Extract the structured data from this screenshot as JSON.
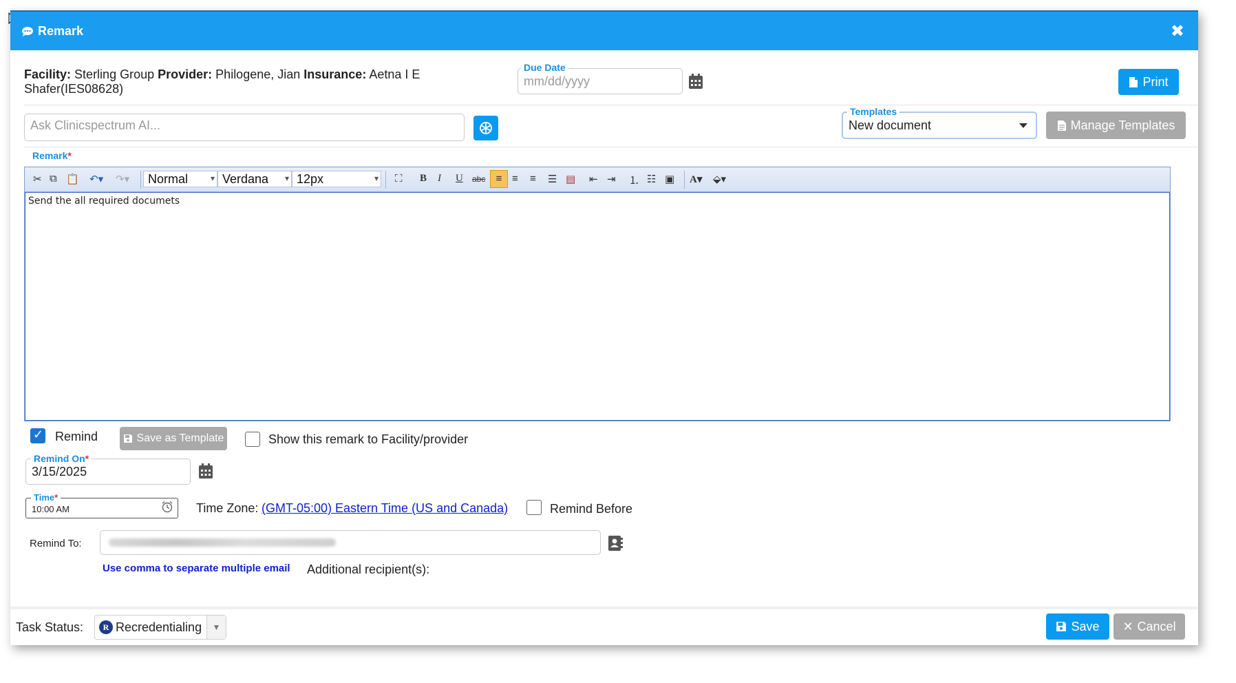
{
  "dialog": {
    "title": "Remark",
    "close_symbol": "✖"
  },
  "info": {
    "facility_label": "Facility:",
    "facility_value": "Sterling Group",
    "provider_label": "Provider:",
    "provider_value": "Philogene, Jian",
    "insurance_label": "Insurance:",
    "insurance_value": "Aetna I E Shafer(IES08628)"
  },
  "due_date": {
    "label": "Due Date",
    "placeholder": "mm/dd/yyyy"
  },
  "print_label": "Print",
  "ai": {
    "placeholder": "Ask Clinicspectrum AI..."
  },
  "templates": {
    "label": "Templates",
    "selected": "New document",
    "manage_label": "Manage Templates"
  },
  "remark": {
    "label": "Remark",
    "required_mark": "*",
    "body": "Send the all required documets"
  },
  "toolbar": {
    "format": "Normal",
    "font": "Verdana",
    "size": "12px",
    "bold": "B",
    "italic": "I",
    "underline": "U",
    "strike": "abc",
    "font_color": "A"
  },
  "options": {
    "remind_label": "Remind",
    "remind_checked": true,
    "save_template_label": "Save as Template",
    "show_remark_label": "Show this remark to Facility/provider",
    "show_remark_checked": false
  },
  "remind_on": {
    "label": "Remind On",
    "required_mark": "*",
    "value": "3/15/2025"
  },
  "time": {
    "label": "Time",
    "required_mark": "*",
    "value": "10:00 AM"
  },
  "timezone": {
    "label": "Time Zone:",
    "value": "(GMT-05:00) Eastern Time (US and Canada)"
  },
  "remind_before": {
    "label": "Remind Before",
    "checked": false
  },
  "remind_to": {
    "label": "Remind To:",
    "hint": "Use comma to separate multiple email",
    "additional_label": "Additional recipient(s):"
  },
  "task_status": {
    "label": "Task Status:",
    "badge": "R",
    "value": "Recredentialing"
  },
  "footer": {
    "save_label": "Save",
    "cancel_label": "Cancel"
  },
  "colors": {
    "header": "#1a9cf0",
    "primary_button": "#0a9bf0",
    "secondary_button": "#a9a9a9",
    "label_accent": "#1a8fe0",
    "link": "#1020d0"
  }
}
